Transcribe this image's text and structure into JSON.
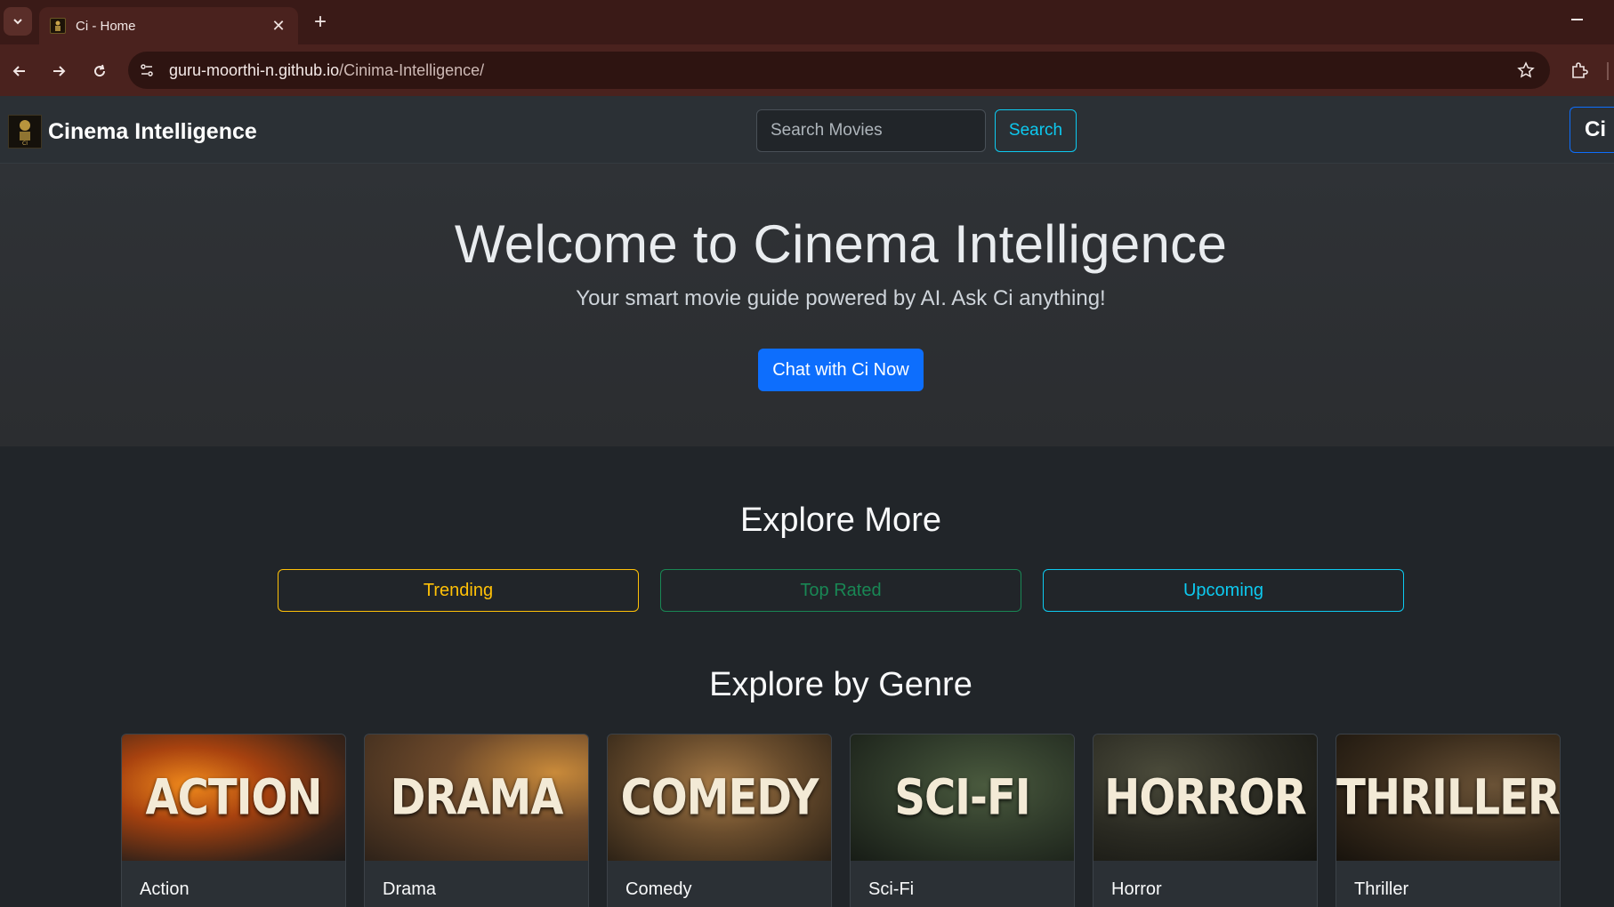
{
  "browser": {
    "tab_title": "Ci - Home",
    "url_host": "guru-moorthi-n.github.io",
    "url_path": "/Cinima-Intelligence/"
  },
  "navbar": {
    "brand": "Cinema Intelligence",
    "search_placeholder": "Search Movies",
    "search_button": "Search",
    "ci_button": "Ci"
  },
  "hero": {
    "title": "Welcome to Cinema Intelligence",
    "subtitle": "Your smart movie guide powered by AI. Ask Ci anything!",
    "cta": "Chat with Ci Now"
  },
  "explore": {
    "title": "Explore More",
    "buttons": [
      {
        "label": "Trending",
        "color": "#ffc107"
      },
      {
        "label": "Top Rated",
        "color": "#198754"
      },
      {
        "label": "Upcoming",
        "color": "#0dcaf0"
      }
    ]
  },
  "genres": {
    "title": "Explore by Genre",
    "items": [
      {
        "image_text": "ACTION",
        "label": "Action"
      },
      {
        "image_text": "DRAMA",
        "label": "Drama"
      },
      {
        "image_text": "COMEDY",
        "label": "Comedy"
      },
      {
        "image_text": "SCI-FI",
        "label": "Sci-Fi"
      },
      {
        "image_text": "HORROR",
        "label": "Horror"
      },
      {
        "image_text": "THRILLER",
        "label": "Thriller"
      }
    ]
  },
  "colors": {
    "primary": "#0d6efd",
    "info": "#0dcaf0",
    "warning": "#ffc107",
    "success": "#198754",
    "page_bg": "#212529",
    "navbar_bg": "#2b3035"
  }
}
